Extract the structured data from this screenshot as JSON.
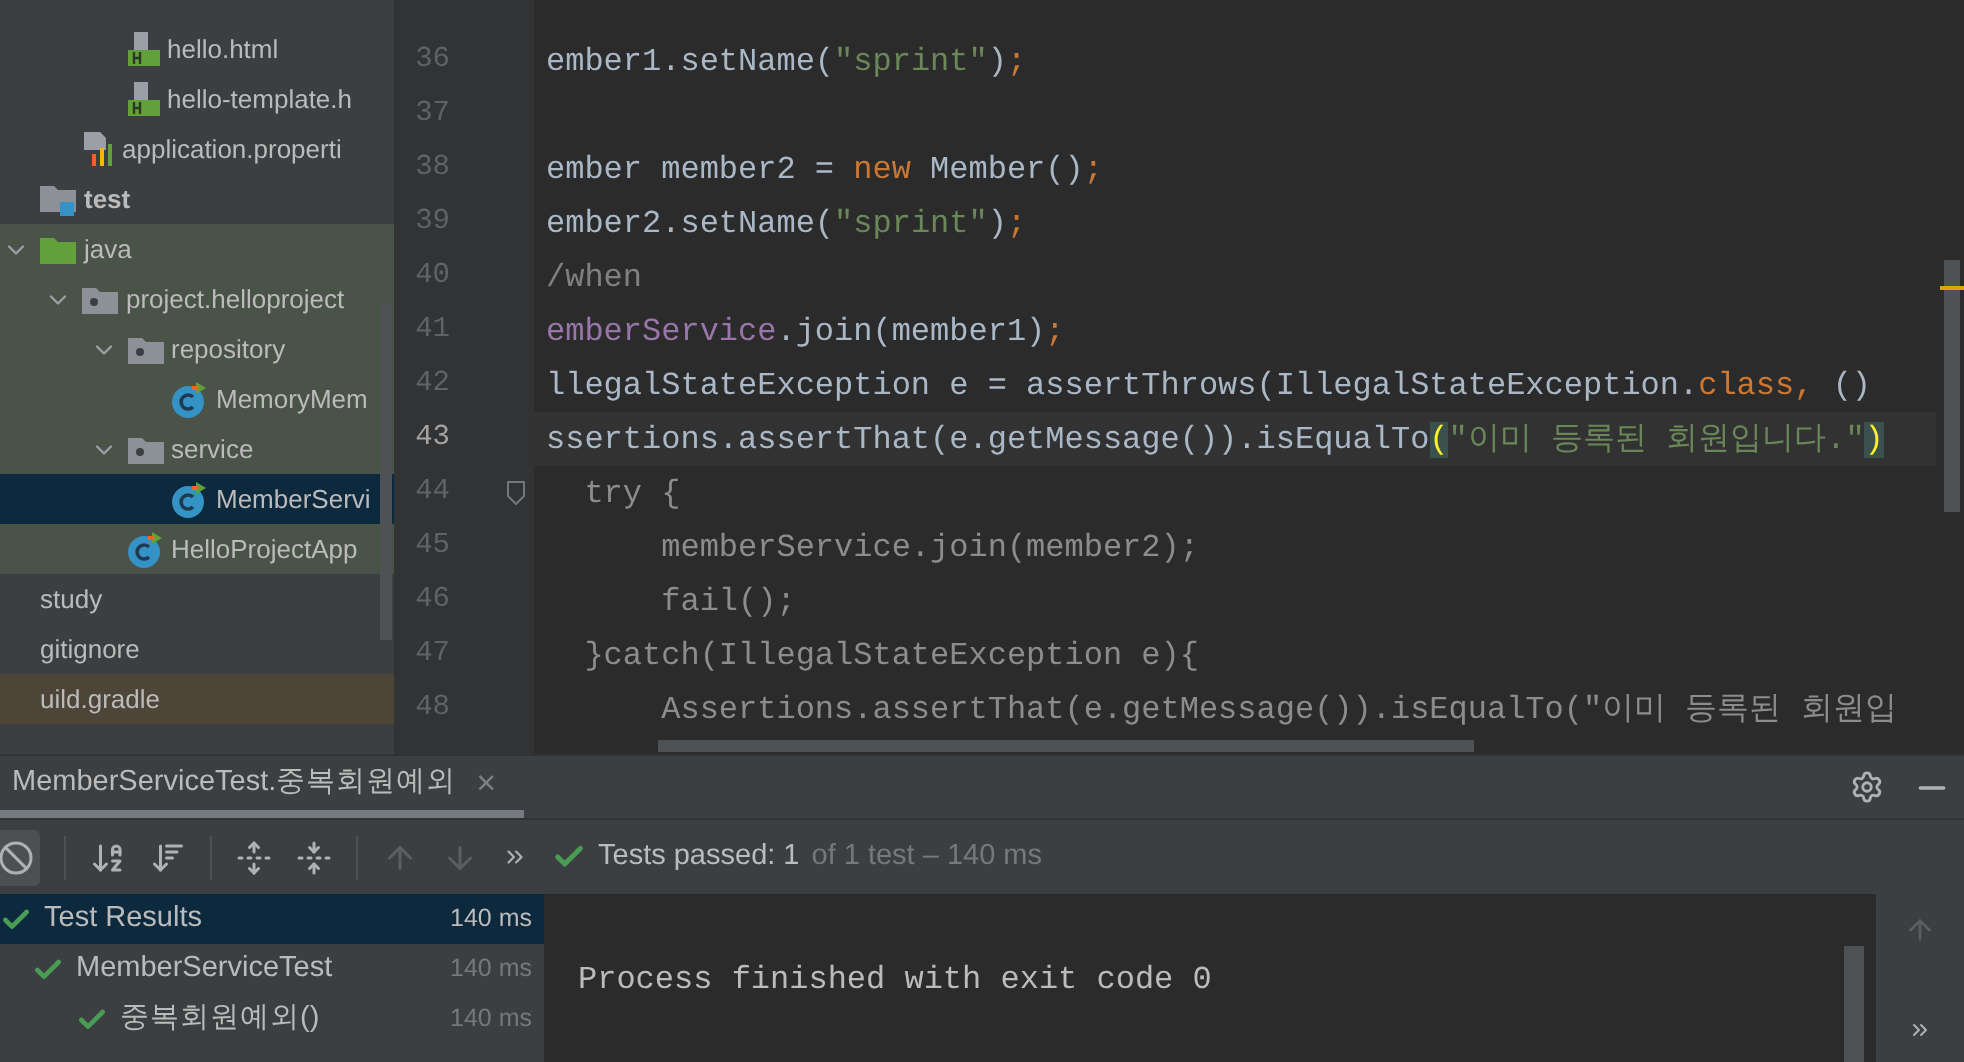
{
  "resources_tail": [
    {
      "name": "hello.html",
      "kind": "html",
      "selected": false
    },
    {
      "name": "hello-template.h",
      "kind": "html",
      "selected": false
    },
    {
      "name": "application.properti",
      "kind": "properties",
      "selected": false
    }
  ],
  "project_tree": [
    {
      "name": "test",
      "kind": "test-root",
      "bold": true,
      "selected": false,
      "children": [
        {
          "name": "java",
          "kind": "java-folder",
          "expanded": true,
          "bold": false,
          "selected": false,
          "color": "#4a5347",
          "children": [
            {
              "name": "project.helloproject",
              "kind": "package",
              "expanded": true,
              "bold": false,
              "selected": false,
              "color": "#4a5347",
              "children": [
                {
                  "name": "repository",
                  "kind": "package",
                  "expanded": true,
                  "bold": false,
                  "selected": false,
                  "color": "#4a5347",
                  "children": [
                    {
                      "name": "MemoryMem",
                      "kind": "class",
                      "bold": false,
                      "selected": false,
                      "color": "#4a5347"
                    }
                  ]
                },
                {
                  "name": "service",
                  "kind": "package",
                  "expanded": true,
                  "bold": false,
                  "selected": false,
                  "color": "#4a5347",
                  "children": [
                    {
                      "name": "MemberServi",
                      "kind": "class",
                      "bold": false,
                      "selected": true,
                      "color": "#4a5347"
                    }
                  ]
                },
                {
                  "name": "HelloProjectApp",
                  "kind": "class",
                  "bold": false,
                  "selected": false,
                  "color": "#4a5347"
                }
              ]
            }
          ]
        }
      ]
    },
    {
      "name": "study",
      "kind": "none",
      "bold": false,
      "selected": false
    },
    {
      "name": "gitignore",
      "kind": "none",
      "bold": false,
      "selected": false
    },
    {
      "name": "uild.gradle",
      "kind": "none",
      "bold": false,
      "selected": false,
      "color": "#4d4638"
    }
  ],
  "editor": {
    "lines": [
      {
        "number": "36",
        "current": false,
        "dimmed": false,
        "tokens": [
          {
            "kind": "plain",
            "text": "ember1.setName("
          },
          {
            "kind": "string",
            "text": "\"sprint\""
          },
          {
            "kind": "plain",
            "text": ")"
          },
          {
            "kind": "keyword",
            "text": ";"
          }
        ]
      },
      {
        "number": "37",
        "current": false
      },
      {
        "number": "38",
        "current": false,
        "dimmed": false,
        "tokens": [
          {
            "kind": "plain",
            "text": "ember member2 = "
          },
          {
            "kind": "keyword",
            "text": "new"
          },
          {
            "kind": "plain",
            "text": " Member()"
          },
          {
            "kind": "keyword",
            "text": ";"
          }
        ]
      },
      {
        "number": "39",
        "current": false,
        "dimmed": false,
        "tokens": [
          {
            "kind": "plain",
            "text": "ember2.setName("
          },
          {
            "kind": "string",
            "text": "\"sprint\""
          },
          {
            "kind": "plain",
            "text": ")"
          },
          {
            "kind": "keyword",
            "text": ";"
          }
        ]
      },
      {
        "number": "40",
        "current": false,
        "dimmed": false,
        "tokens": [
          {
            "kind": "comment",
            "text": "/when"
          }
        ]
      },
      {
        "number": "41",
        "current": false,
        "dimmed": false,
        "tokens": [
          {
            "kind": "field",
            "text": "emberService"
          },
          {
            "kind": "plain",
            "text": ".join(member1)"
          },
          {
            "kind": "keyword",
            "text": ";"
          }
        ]
      },
      {
        "number": "42",
        "current": false,
        "dimmed": false,
        "tokens": [
          {
            "kind": "plain",
            "text": "llegalStateException e = assertThrows(IllegalStateException."
          },
          {
            "kind": "keyword",
            "text": "class"
          },
          {
            "kind": "keyword",
            "text": ","
          },
          {
            "kind": "plain",
            "text": " ()"
          }
        ]
      },
      {
        "number": "43",
        "current": true,
        "dimmed": false,
        "tokens": [
          {
            "kind": "plain",
            "text": "ssertions.assertThat(e.getMessage()).isEqualTo"
          },
          {
            "kind": "brace",
            "text": "("
          },
          {
            "kind": "string",
            "text": "\"이미 등록된 회원입니다.\""
          },
          {
            "kind": "brace",
            "text": ")"
          }
        ]
      },
      {
        "number": "44",
        "current": false,
        "dimmed": true,
        "fold": true,
        "tokens": [
          {
            "kind": "plain",
            "text": "  try {"
          }
        ]
      },
      {
        "number": "45",
        "current": false,
        "dimmed": true,
        "tokens": [
          {
            "kind": "plain",
            "text": "      memberService.join(member2);"
          }
        ]
      },
      {
        "number": "46",
        "current": false,
        "dimmed": true,
        "tokens": [
          {
            "kind": "plain",
            "text": "      fail();"
          }
        ]
      },
      {
        "number": "47",
        "current": false,
        "dimmed": true,
        "tokens": [
          {
            "kind": "plain",
            "text": "  }catch(IllegalStateException e){"
          }
        ]
      },
      {
        "number": "48",
        "current": false,
        "dimmed": true,
        "tokens": [
          {
            "kind": "plain",
            "text": "      Assertions.assertThat(e.getMessage()).isEqualTo(\"이미 등록된 회원입"
          }
        ]
      }
    ]
  },
  "run_panel": {
    "tab": {
      "label": "MemberServiceTest.중복회원예외",
      "close": "×",
      "selected": true
    },
    "status": {
      "passed": "Tests passed: 1",
      "detail": "of 1 test – 140 ms"
    },
    "results": [
      {
        "name": "Test Results",
        "time": "140 ms",
        "selected": true,
        "passed": true,
        "children": [
          {
            "name": "MemberServiceTest",
            "time": "140 ms",
            "selected": false,
            "passed": true,
            "children": [
              {
                "name": "중복회원예외()",
                "time": "140 ms",
                "selected": false,
                "passed": true
              }
            ]
          }
        ]
      }
    ],
    "console": "Process finished with exit code 0"
  }
}
